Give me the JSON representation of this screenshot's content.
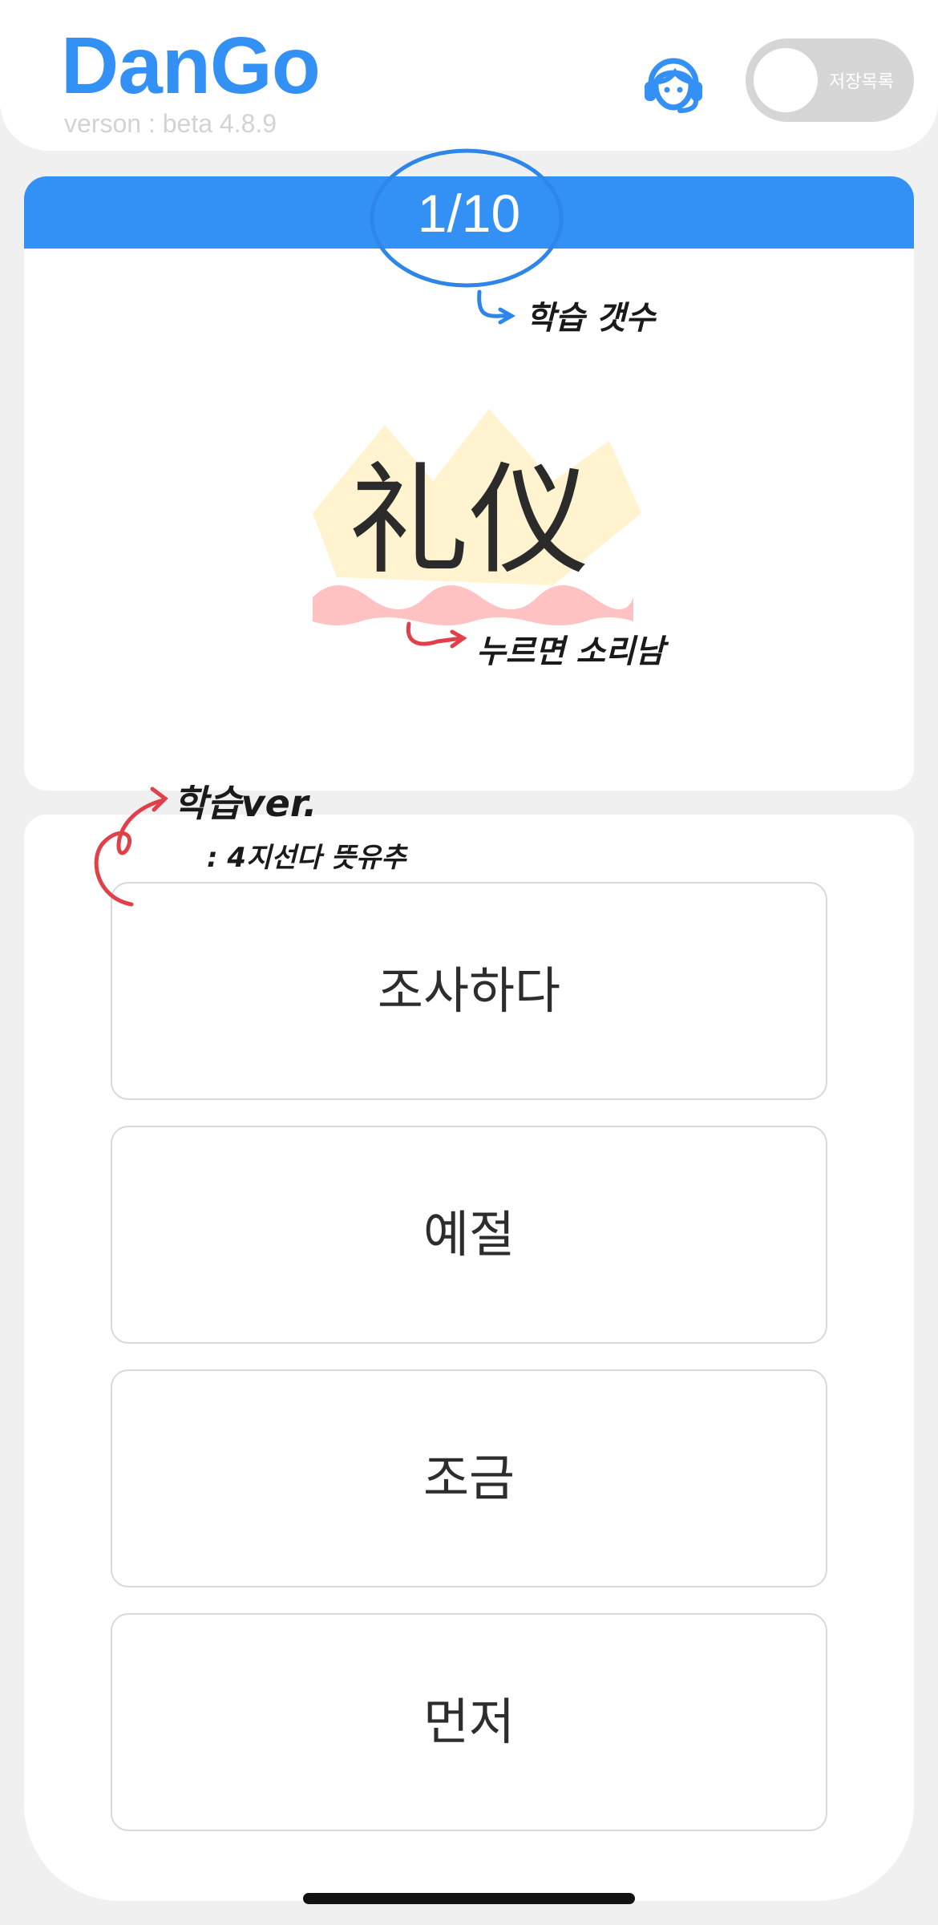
{
  "app": {
    "logo": "DanGo",
    "version": "verson : beta 4.8.9",
    "toggle_label": "저장목록",
    "accent_color": "#3391f5"
  },
  "quiz": {
    "progress": "1/10",
    "word": "礼仪",
    "options": [
      "조사하다",
      "예절",
      "조금",
      "먼저"
    ]
  },
  "annotations": {
    "progress_note": "학습 갯수",
    "sound_note": "누르면 소리남",
    "mode_note": "학습ver.",
    "mode_detail": ": 4지선다 뜻유추"
  },
  "icons": {
    "headset": "headset-icon"
  }
}
